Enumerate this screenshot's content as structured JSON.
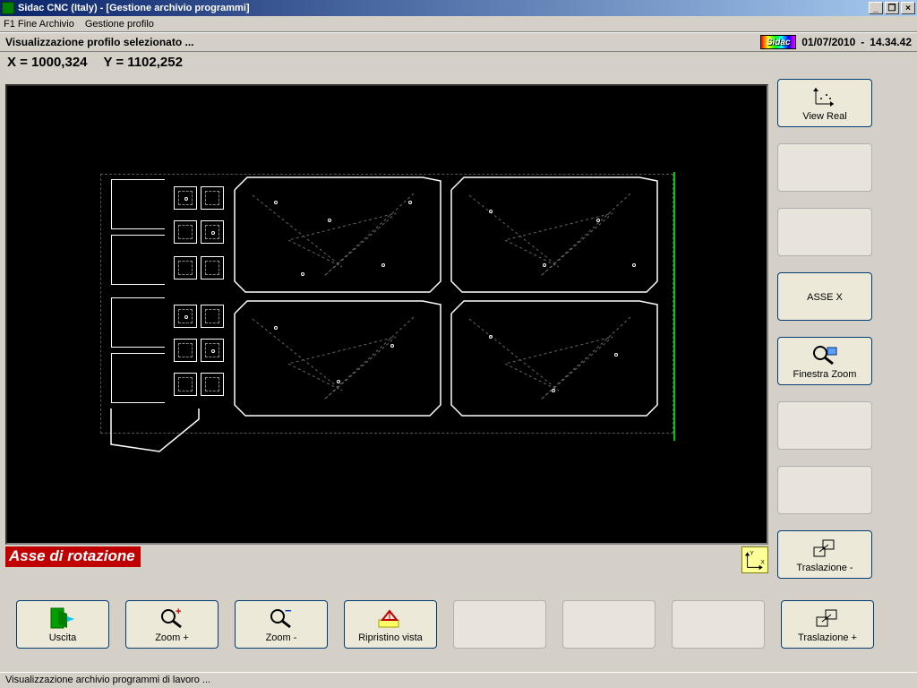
{
  "title": "Sidac CNC (Italy) - [Gestione archivio programmi]",
  "menu": {
    "item1": "F1 Fine Archivio",
    "item2": "Gestione profilo"
  },
  "infobar": {
    "text": "Visualizzazione profilo selezionato ...",
    "logo": "Sidac",
    "date": "01/07/2010",
    "sep": "-",
    "time": "14.34.42"
  },
  "coords": {
    "xlabel": "X =",
    "xval": "1000,324",
    "ylabel": "Y =",
    "yval": "1102,252"
  },
  "asse_rotazione": "Asse di rotazione",
  "side": {
    "view_real": "View Real",
    "asse_x": "ASSE X",
    "finestra_zoom": "Finestra Zoom",
    "traslazione_minus": "Traslazione -"
  },
  "bottom": {
    "uscita": "Uscita",
    "zoom_plus": "Zoom +",
    "zoom_minus": "Zoom -",
    "ripristino": "Ripristino vista",
    "traslazione_plus": "Traslazione +"
  },
  "status": "Visualizzazione archivio programmi di lavoro ...",
  "colors": {
    "accent_red": "#c00000",
    "canvas_bg": "#000000",
    "guide_green": "#00c800"
  }
}
